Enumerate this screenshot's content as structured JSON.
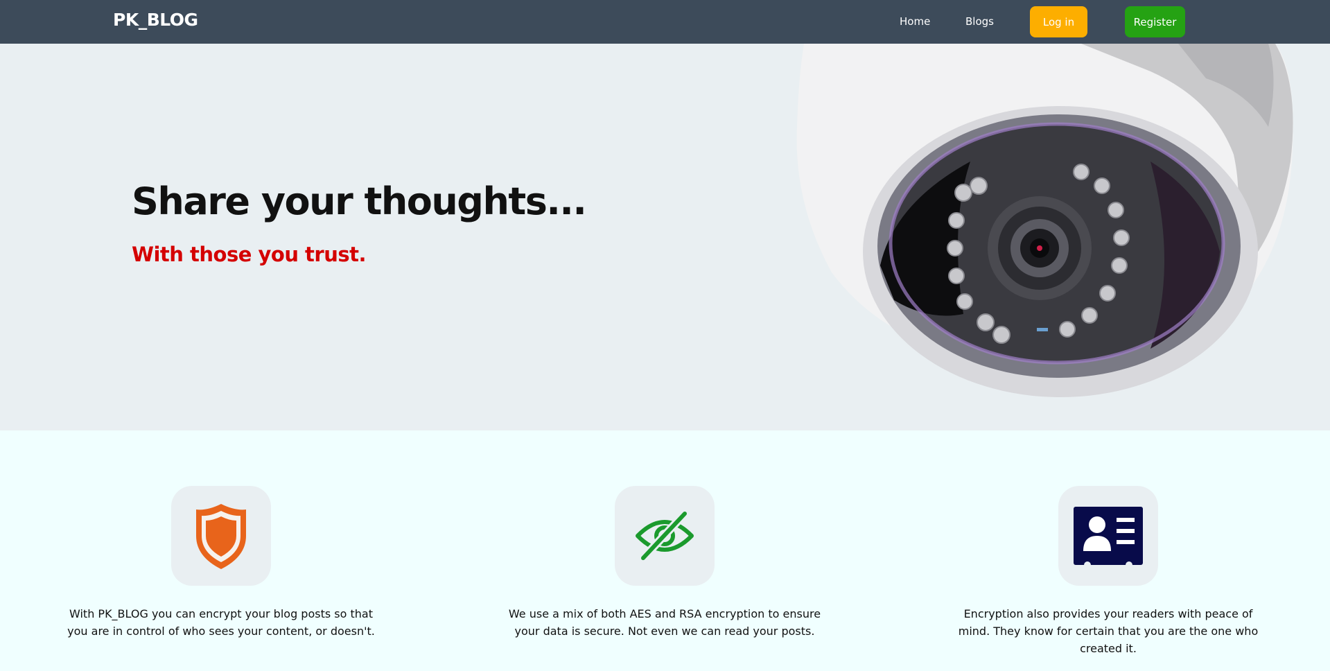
{
  "navbar": {
    "brand": "PK_BLOG",
    "links": [
      {
        "label": "Home"
      },
      {
        "label": "Blogs"
      }
    ],
    "login_label": "Log in",
    "register_label": "Register",
    "colors": {
      "background": "#3d4b5a",
      "login": "#fdae00",
      "register": "#25a213"
    }
  },
  "hero": {
    "title": "Share your thoughts...",
    "subtitle": "With those you trust.",
    "image": "security-camera-illustration",
    "colors": {
      "subtitle": "#d40000"
    }
  },
  "features": [
    {
      "icon": "shield-icon",
      "text": "With PK_BLOG you can encrypt your blog posts so that you are in control of who sees your content, or doesn't."
    },
    {
      "icon": "eye-slash-icon",
      "text": "We use a mix of both AES and RSA encryption to ensure your data is secure. Not even we can read your posts."
    },
    {
      "icon": "id-card-icon",
      "text": "Encryption also provides your readers with peace of mind. They know for certain that you are the one who created it."
    }
  ]
}
